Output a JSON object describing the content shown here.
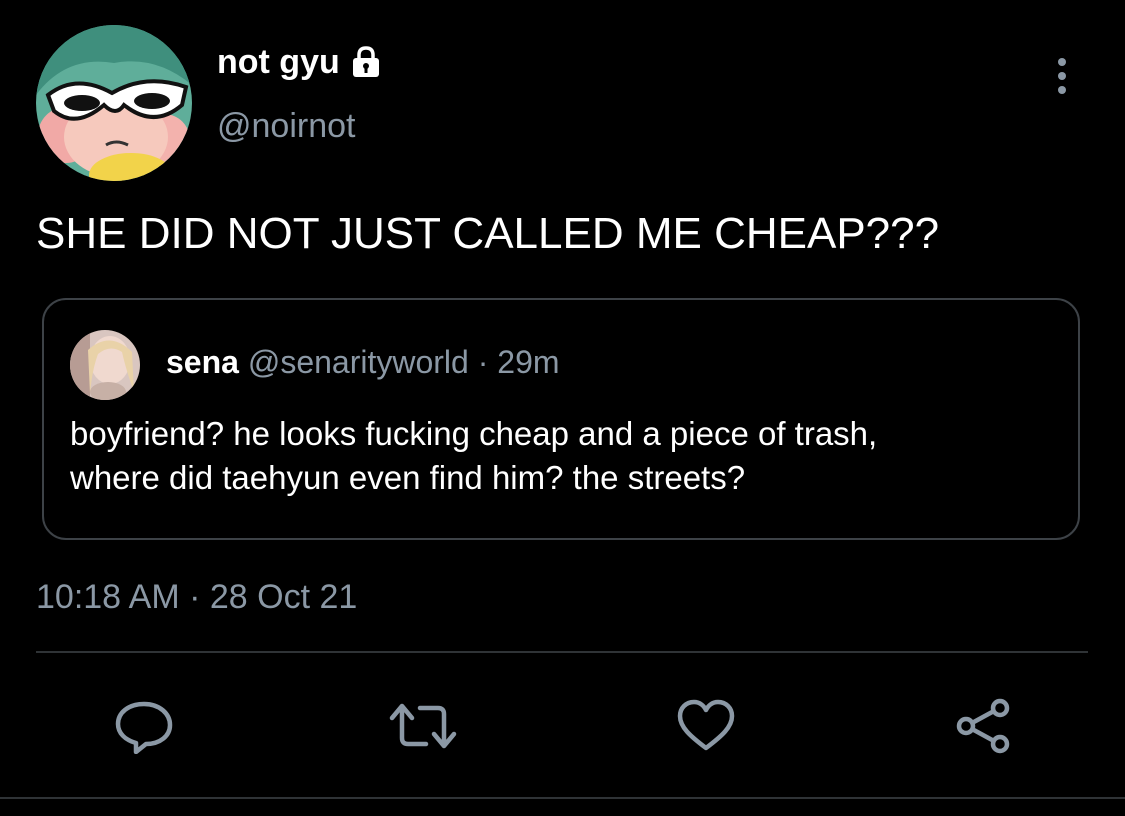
{
  "tweet": {
    "author": {
      "display_name": "not gyu",
      "handle": "@noirnot",
      "protected": true,
      "avatar": "powerpuff-girl-with-sunglasses"
    },
    "text": "SHE DID NOT JUST CALLED ME CHEAP???",
    "quoted": {
      "name": "sena",
      "handle": "@senarityworld",
      "separator": "·",
      "time": "29m",
      "avatar": "profile-photo",
      "text_lines": [
        "boyfriend? he looks fucking cheap and a piece of trash,",
        "where did taehyun even find him? the streets?"
      ]
    },
    "timestamp": "10:18 AM · 28 Oct 21"
  },
  "actions": [
    "reply-icon",
    "retweet-icon",
    "like-icon",
    "share-icon"
  ],
  "colors": {
    "background": "#000000",
    "text": "#ffffff",
    "secondary_text": "#8b98a5",
    "border": "#3d4247"
  }
}
